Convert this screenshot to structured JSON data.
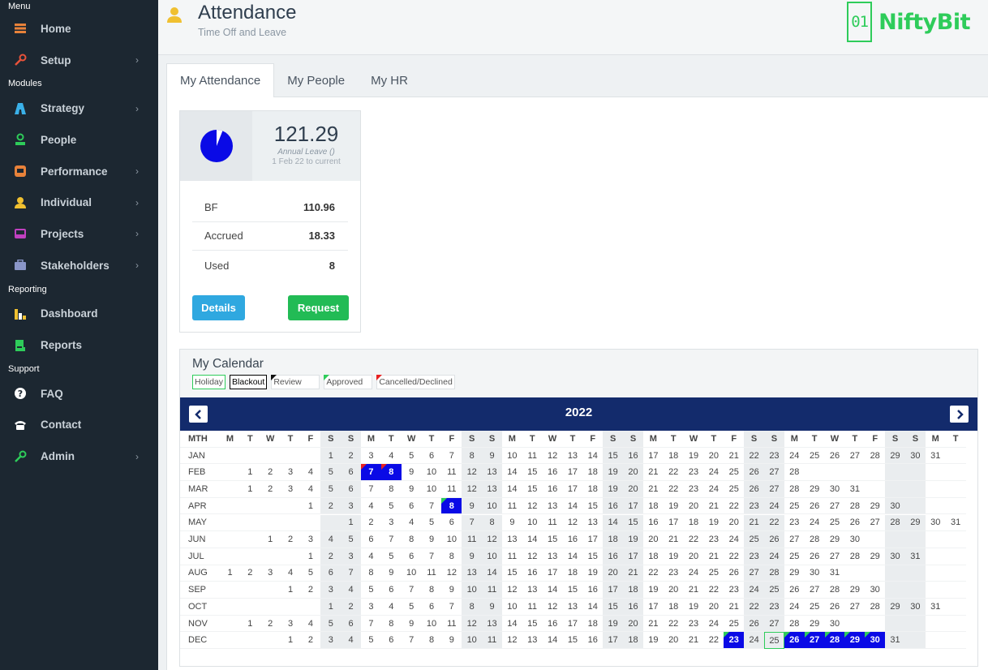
{
  "sidebar": {
    "sections": [
      "Menu",
      "Modules",
      "Reporting",
      "Support"
    ],
    "items": [
      {
        "label": "Home",
        "icon": "home-icon",
        "color": "#e8823a"
      },
      {
        "label": "Setup",
        "icon": "wrench-icon",
        "color": "#e8523a"
      },
      {
        "label": "Strategy",
        "icon": "road-icon",
        "color": "#3ab0e8"
      },
      {
        "label": "People",
        "icon": "user-icon",
        "color": "#2ecc5a"
      },
      {
        "label": "Performance",
        "icon": "performance-icon",
        "color": "#e8823a"
      },
      {
        "label": "Individual",
        "icon": "person-icon",
        "color": "#f0c030"
      },
      {
        "label": "Projects",
        "icon": "inbox-icon",
        "color": "#c040c0"
      },
      {
        "label": "Stakeholders",
        "icon": "briefcase-icon",
        "color": "#8a96c8"
      },
      {
        "label": "Dashboard",
        "icon": "dashboard-icon",
        "color": "#f0c030"
      },
      {
        "label": "Reports",
        "icon": "reports-icon",
        "color": "#2ecc5a"
      },
      {
        "label": "FAQ",
        "icon": "question-icon",
        "color": "#ffffff"
      },
      {
        "label": "Contact",
        "icon": "phone-icon",
        "color": "#ffffff"
      },
      {
        "label": "Admin",
        "icon": "wrench-icon",
        "color": "#2ecc5a"
      }
    ]
  },
  "header": {
    "title": "Attendance",
    "subtitle": "Time Off and Leave",
    "logo_mark": "01",
    "logo_text": "NiftyBit"
  },
  "tabs": [
    "My Attendance",
    "My People",
    "My HR"
  ],
  "leave": {
    "balance": "121.29",
    "type_label": "Annual Leave ()",
    "range": "1 Feb 22 to current",
    "pie_used_fraction": 0.06,
    "rows": [
      {
        "label": "BF",
        "value": "110.96"
      },
      {
        "label": "Accrued",
        "value": "18.33"
      },
      {
        "label": "Used",
        "value": "8"
      }
    ],
    "details_label": "Details",
    "request_label": "Request"
  },
  "calendar": {
    "title": "My Calendar",
    "legend": {
      "holiday": "Holiday",
      "blackout": "Blackout",
      "review": "Review",
      "approved": "Approved",
      "cancelled": "Cancelled/Declined"
    },
    "year": "2022",
    "mth_header": "MTH",
    "weekdays": [
      "M",
      "T",
      "W",
      "T",
      "F",
      "S",
      "S"
    ],
    "months": [
      "JAN",
      "FEB",
      "MAR",
      "APR",
      "MAY",
      "JUN",
      "JUL",
      "AUG",
      "SEP",
      "OCT",
      "NOV",
      "DEC"
    ],
    "month_days": [
      31,
      28,
      31,
      30,
      31,
      30,
      31,
      31,
      30,
      31,
      30,
      31
    ],
    "month_start_col": [
      5,
      1,
      1,
      4,
      6,
      2,
      4,
      0,
      3,
      5,
      1,
      3
    ],
    "highlights": [
      {
        "month": 1,
        "day": 7,
        "marker": "cancelled"
      },
      {
        "month": 1,
        "day": 8,
        "marker": "cancelled"
      },
      {
        "month": 3,
        "day": 8,
        "marker": "approved"
      },
      {
        "month": 11,
        "day": 23,
        "marker": "approved"
      },
      {
        "month": 11,
        "day": 26,
        "marker": "approved"
      },
      {
        "month": 11,
        "day": 27,
        "marker": "approved"
      },
      {
        "month": 11,
        "day": 28,
        "marker": "approved"
      },
      {
        "month": 11,
        "day": 29,
        "marker": "approved"
      },
      {
        "month": 11,
        "day": 30,
        "marker": "approved"
      }
    ],
    "holidays": [
      {
        "month": 11,
        "day": 25
      }
    ],
    "colors": {
      "approved": "#2ecc5a",
      "cancelled": "#e82020",
      "review": "#111111",
      "highlight": "#0a0ae6"
    }
  }
}
